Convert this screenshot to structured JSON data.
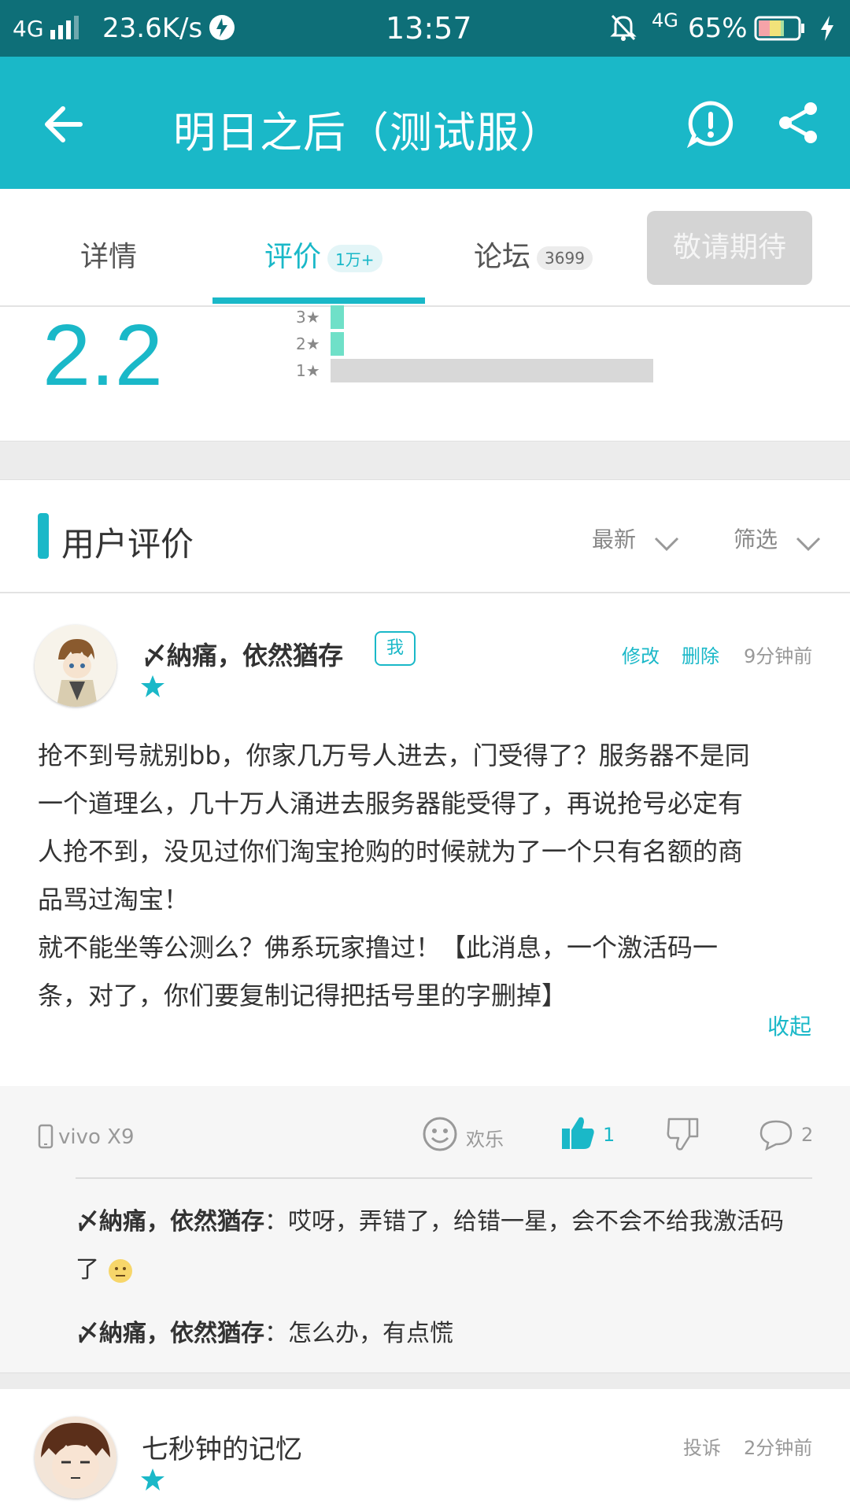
{
  "status_bar": {
    "network": "4G",
    "speed": "23.6K/s",
    "time": "13:57",
    "net_right": "4G",
    "battery": "65%"
  },
  "header": {
    "title": "明日之后（测试服）"
  },
  "tabs": [
    {
      "label": "详情",
      "badge": ""
    },
    {
      "label": "评价",
      "badge": "1万+"
    },
    {
      "label": "论坛",
      "badge": "3699"
    }
  ],
  "expect_button": "敬请期待",
  "rating": {
    "score": "2.2",
    "rows": [
      {
        "label": "3",
        "fraction": 0.03
      },
      {
        "label": "2",
        "fraction": 0.03
      },
      {
        "label": "1",
        "fraction": 0.72
      }
    ]
  },
  "section": {
    "title": "用户评价",
    "sort_label": "最新",
    "filter_label": "筛选"
  },
  "reviews": [
    {
      "username": "〆納痛，依然猶存",
      "me_badge": "我",
      "edit": "修改",
      "delete": "删除",
      "time": "9分钟前",
      "stars": 1,
      "text": "抢不到号就别bb，你家几万号人进去，门受得了？服务器不是同\n一个道理么，几十万人涌进去服务器能受得了，再说抢号必定有\n人抢不到，没见过你们淘宝抢购的时候就为了一个只有名额的商\n品骂过淘宝！\n就不能坐等公测么？佛系玩家撸过！【此消息，一个激活码一\n条，对了，你们要复制记得把括号里的字删掉】",
      "collapse": "收起",
      "device": "vivo X9",
      "emotion": "欢乐",
      "likes": "1",
      "comments": "2",
      "replies": [
        {
          "author": "〆納痛，依然猶存",
          "text": "：哎呀，弄错了，给错一星，会不会不给我激活码",
          "text2": "了"
        },
        {
          "author": "〆納痛，依然猶存",
          "text": "：怎么办，有点慌",
          "text2": ""
        }
      ]
    },
    {
      "username": "七秒钟的记忆",
      "report": "投诉",
      "time": "2分钟前",
      "stars": 1
    }
  ],
  "colors": {
    "accent": "#1ab8c8",
    "status_bar": "#0e6f78",
    "rating_bar": "#6fe0c8",
    "rating_bar_gray": "#d8d8d8"
  }
}
